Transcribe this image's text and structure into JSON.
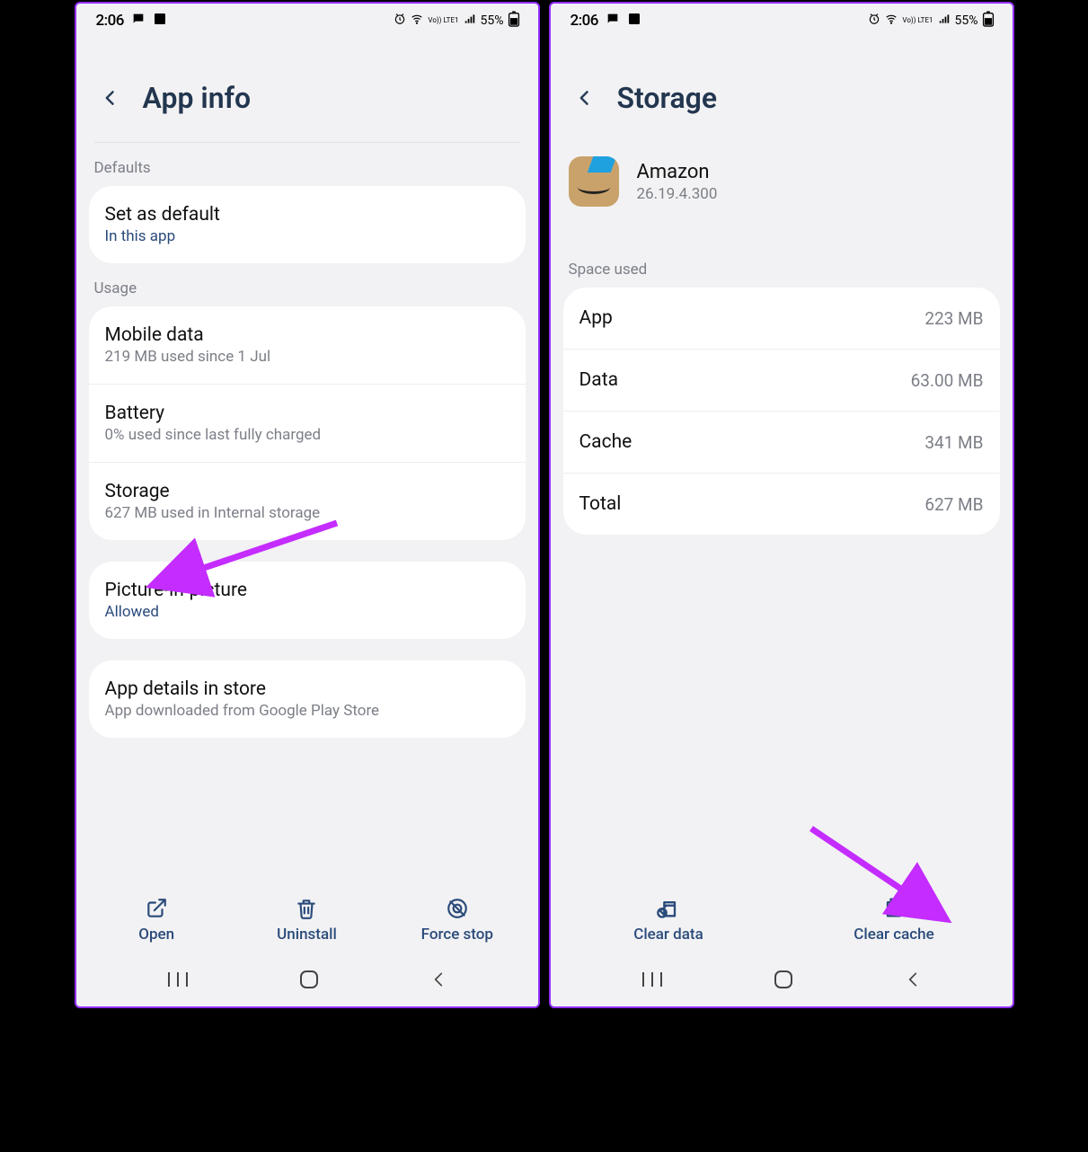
{
  "status": {
    "time": "2:06",
    "battery_text": "55%",
    "lte_label": "Vo)) LTE1"
  },
  "left": {
    "title": "App info",
    "section_defaults": "Defaults",
    "set_default": {
      "title": "Set as default",
      "sub": "In this app"
    },
    "section_usage": "Usage",
    "mobile_data": {
      "title": "Mobile data",
      "sub": "219 MB used since 1 Jul"
    },
    "battery": {
      "title": "Battery",
      "sub": "0% used since last fully charged"
    },
    "storage": {
      "title": "Storage",
      "sub": "627 MB used in Internal storage"
    },
    "pip": {
      "title": "Picture-in-picture",
      "sub": "Allowed"
    },
    "store": {
      "title": "App details in store",
      "sub": "App downloaded from Google Play Store"
    },
    "actions": {
      "open": "Open",
      "uninstall": "Uninstall",
      "force_stop": "Force stop"
    }
  },
  "right": {
    "title": "Storage",
    "app_name": "Amazon",
    "app_version": "26.19.4.300",
    "section_space": "Space used",
    "rows": {
      "app": {
        "k": "App",
        "v": "223 MB"
      },
      "data": {
        "k": "Data",
        "v": "63.00 MB"
      },
      "cache": {
        "k": "Cache",
        "v": "341 MB"
      },
      "total": {
        "k": "Total",
        "v": "627 MB"
      }
    },
    "actions": {
      "clear_data": "Clear data",
      "clear_cache": "Clear cache"
    }
  }
}
